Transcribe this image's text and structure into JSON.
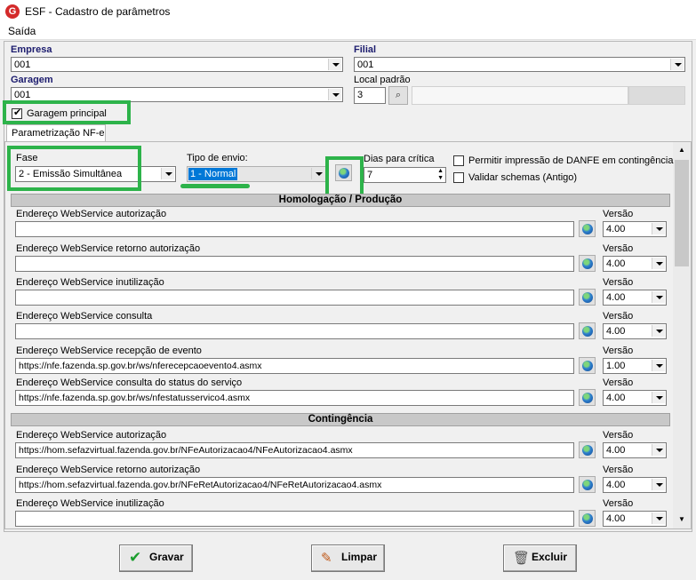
{
  "window": {
    "app_icon": "G",
    "title": "ESF - Cadastro de parâmetros"
  },
  "menu": {
    "saida": "Saída"
  },
  "empresa": {
    "label": "Empresa",
    "value": "001"
  },
  "filial": {
    "label": "Filial",
    "value": "001"
  },
  "garagem": {
    "label": "Garagem",
    "value": "001"
  },
  "local_padrao": {
    "label": "Local padrão",
    "value": "3"
  },
  "garagem_principal": {
    "label": "Garagem principal",
    "checked": true
  },
  "tab": {
    "label": "Parametrização NF-e"
  },
  "fase": {
    "label": "Fase",
    "value": "2 - Emissão Simultânea"
  },
  "tipo_envio": {
    "label": "Tipo de envio:",
    "value": "1 - Normal"
  },
  "dias_critica": {
    "label": "Dias para crítica",
    "value": "7"
  },
  "options": {
    "permitir_danfe": "Permitir impressão de DANFE em contingência",
    "validar_schemas": "Validar schemas (Antigo)"
  },
  "homologacao": {
    "header": "Homologação / Produção",
    "version_label": "Versão",
    "rows": [
      {
        "label": "Endereço WebService autorização",
        "url": "",
        "version": "4.00"
      },
      {
        "label": "Endereço WebService retorno autorização",
        "url": "",
        "version": "4.00"
      },
      {
        "label": "Endereço WebService inutilização",
        "url": "",
        "version": "4.00"
      },
      {
        "label": "Endereço WebService consulta",
        "url": "",
        "version": "4.00"
      },
      {
        "label": "Endereço WebService recepção de evento",
        "url": "https://nfe.fazenda.sp.gov.br/ws/nferecepcaoevento4.asmx",
        "version": "1.00"
      },
      {
        "label": "Endereço WebService consulta do status do serviço",
        "url": "https://nfe.fazenda.sp.gov.br/ws/nfestatusservico4.asmx",
        "version": "4.00"
      }
    ]
  },
  "contingencia": {
    "header": "Contingência",
    "version_label": "Versão",
    "rows": [
      {
        "label": "Endereço WebService autorização",
        "url": "https://hom.sefazvirtual.fazenda.gov.br/NFeAutorizacao4/NFeAutorizacao4.asmx",
        "version": "4.00"
      },
      {
        "label": "Endereço WebService retorno autorização",
        "url": "https://hom.sefazvirtual.fazenda.gov.br/NFeRetAutorizacao4/NFeRetAutorizacao4.asmx",
        "version": "4.00"
      },
      {
        "label": "Endereço WebService inutilização",
        "url": "",
        "version": "4.00"
      }
    ]
  },
  "buttons": {
    "gravar": "Gravar",
    "limpar": "Limpar",
    "excluir": "Excluir"
  },
  "colors": {
    "highlight_green": "#2db34a",
    "label_navy": "#1c1c6e",
    "selection_blue": "#0078d7"
  }
}
